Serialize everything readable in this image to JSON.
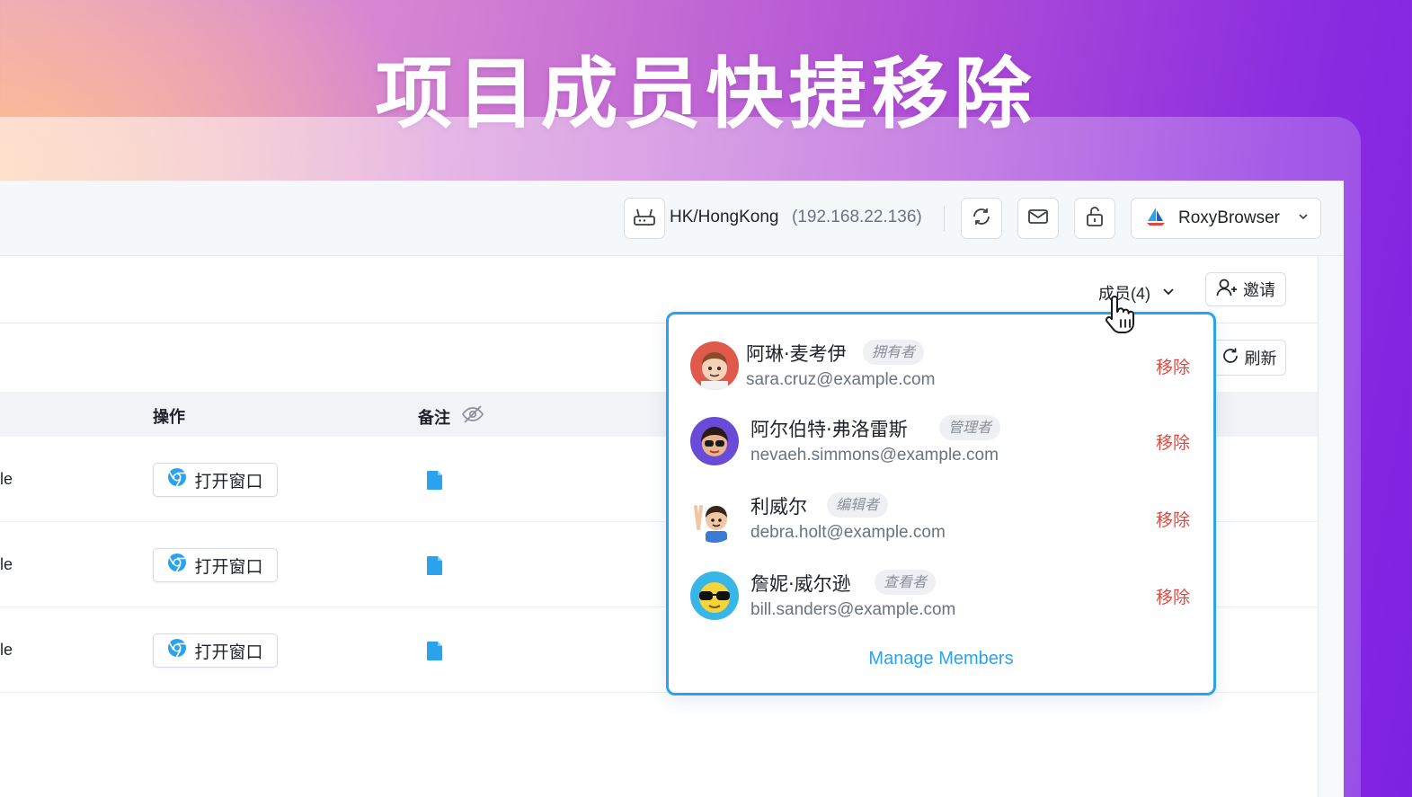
{
  "headline": "项目成员快捷移除",
  "topbar": {
    "proxy_location": "HK/HongKong",
    "proxy_ip": "(192.168.22.136)",
    "profile_name": "RoxyBrowser"
  },
  "panel": {
    "members_label": "成员(4)",
    "invite_label": "邀请",
    "refresh_label": "刷新"
  },
  "table": {
    "headers": {
      "action": "操作",
      "note": "备注"
    },
    "rows": [
      {
        "tail": "le",
        "action_label": "打开窗口"
      },
      {
        "tail": "le",
        "action_label": "打开窗口"
      },
      {
        "tail": "le",
        "action_label": "打开窗口"
      }
    ]
  },
  "members": [
    {
      "name": "阿琳·麦考伊",
      "role": "拥有者",
      "email": "sara.cruz@example.com",
      "remove": "移除",
      "avatar_color": "#e05a4c",
      "avatar_icon": "avatar-red"
    },
    {
      "name": "阿尔伯特·弗洛雷斯",
      "role": "管理者",
      "email": "nevaeh.simmons@example.com",
      "remove": "移除",
      "avatar_color": "#6a4bd8",
      "avatar_icon": "avatar-purple"
    },
    {
      "name": "利威尔",
      "role": "编辑者",
      "email": "debra.holt@example.com",
      "remove": "移除",
      "avatar_color": "#ffffff",
      "avatar_icon": "avatar-waving"
    },
    {
      "name": "詹妮·威尔逊",
      "role": "查看者",
      "email": "bill.sanders@example.com",
      "remove": "移除",
      "avatar_color": "#39b6e8",
      "avatar_icon": "avatar-sunglasses"
    }
  ],
  "manage_members_label": "Manage Members",
  "colors": {
    "accent": "#2aa3ec",
    "danger": "#e0483e"
  }
}
